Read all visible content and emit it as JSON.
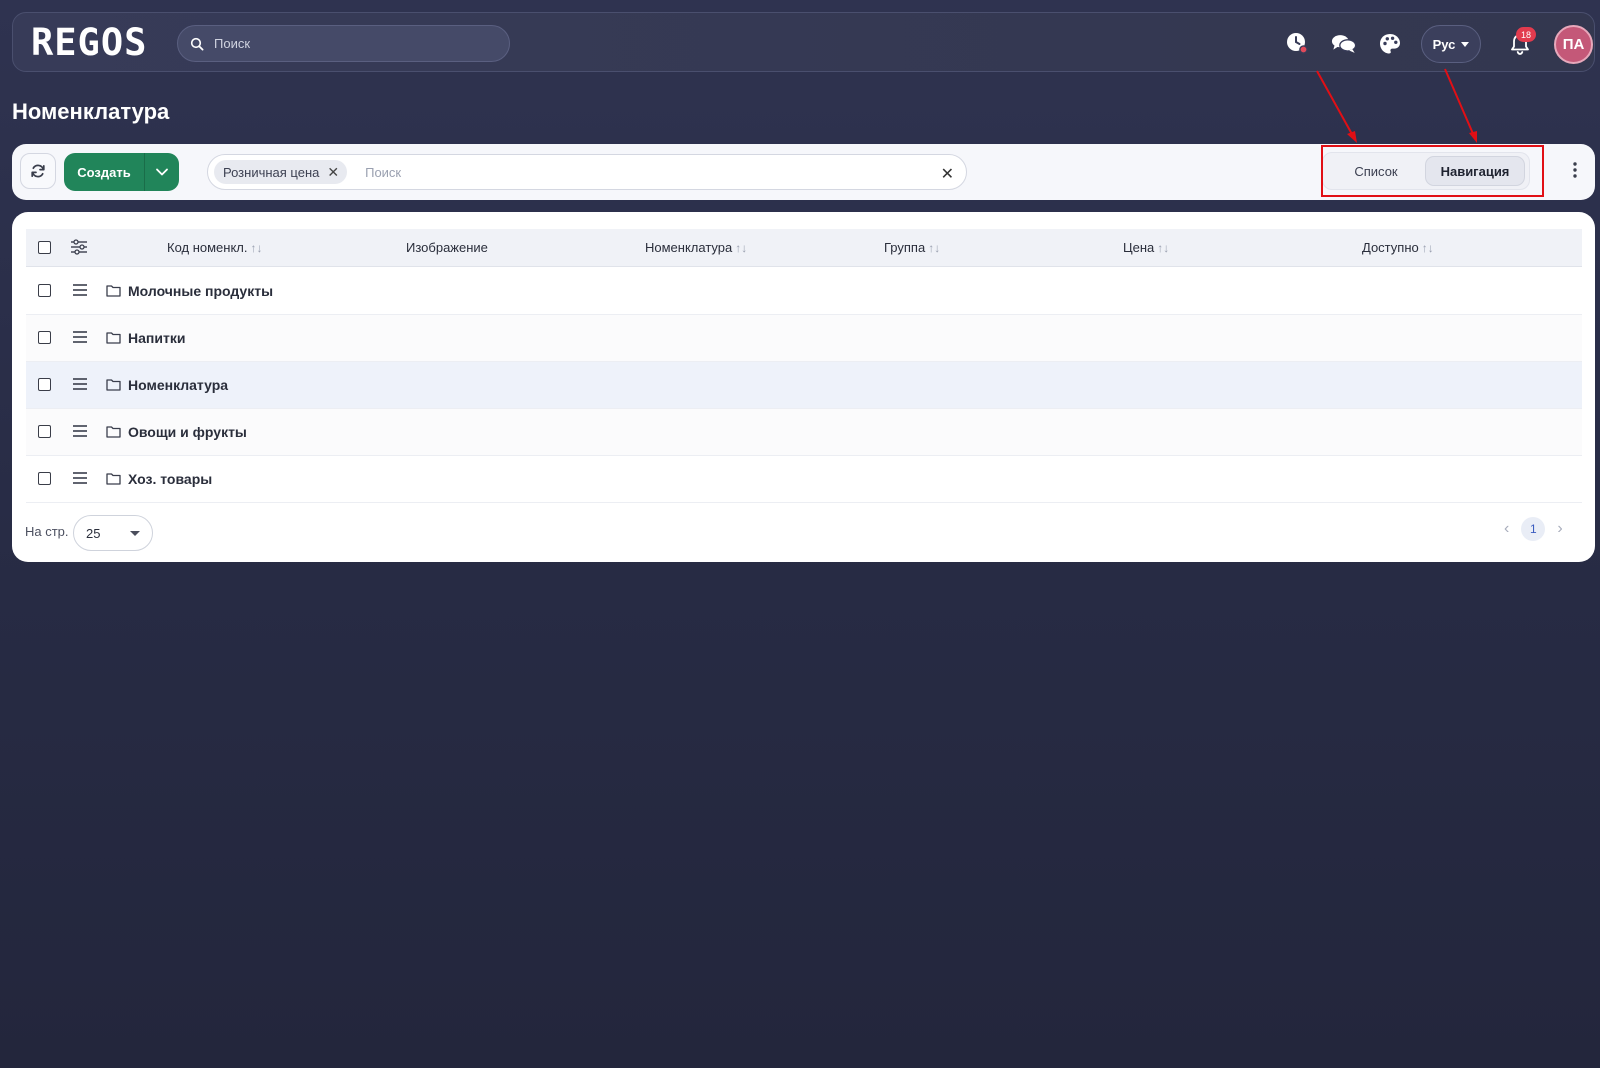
{
  "app": {
    "logo": "REGOS"
  },
  "topbar": {
    "search_placeholder": "Поиск",
    "language": "Рус",
    "notifications_count": "18",
    "avatar_initials": "ПА"
  },
  "page": {
    "title": "Номенклатура"
  },
  "toolbar": {
    "create_label": "Создать",
    "filter_chip": "Розничная цена",
    "filter_placeholder": "Поиск",
    "view_list": "Список",
    "view_navigation": "Навигация",
    "active_view": "Навигация"
  },
  "table": {
    "columns": [
      "Код номенкл.",
      "Изображение",
      "Номенклатура",
      "Группа",
      "Цена",
      "Доступно"
    ],
    "rows": [
      {
        "name": "Молочные продукты"
      },
      {
        "name": "Напитки"
      },
      {
        "name": "Номенклатура"
      },
      {
        "name": "Овощи и фрукты"
      },
      {
        "name": "Хоз. товары"
      }
    ]
  },
  "footer": {
    "per_page_label": "На стр.",
    "per_page_value": "25",
    "current_page": "1"
  },
  "colors": {
    "background": "#2b2f4a",
    "accent_green": "#21855a",
    "highlight_red": "#e10f15",
    "badge_red": "#e23b4e",
    "avatar": "#c45878"
  }
}
